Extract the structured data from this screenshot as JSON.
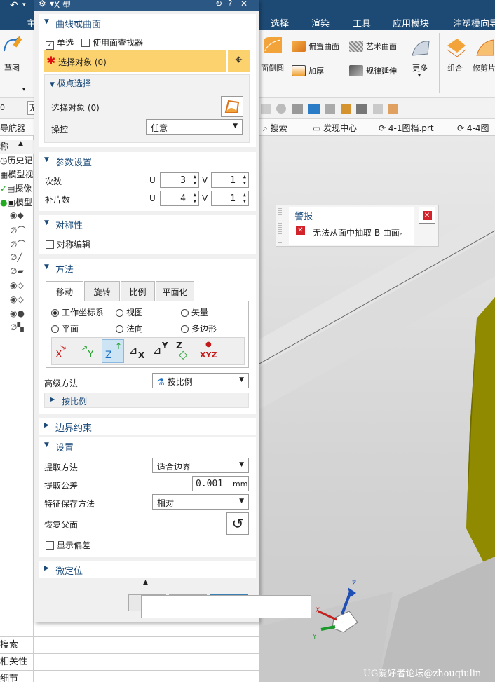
{
  "title_bar": {
    "dialog_title": "X 型",
    "controls": [
      "↻",
      "?",
      "✕"
    ]
  },
  "ribbon_tabs": [
    "选择",
    "渲染",
    "工具",
    "应用模块",
    "注塑模向导"
  ],
  "ribbon_left": {
    "tab_fragment": "主",
    "sketch_label": "草图"
  },
  "ribbon_buttons": {
    "face_fillet": "面倒圆",
    "offset_surface": "偏置曲面",
    "art_surface": "艺术曲面",
    "more": "更多",
    "thicken": "加厚",
    "ruled_extend": "规律延伸",
    "combine": "组合",
    "trim_sheet": "修剪片"
  },
  "toolbar2": {
    "left_values": [
      "0",
      "无"
    ]
  },
  "navbar": {
    "left_label": "导航器",
    "search": "搜索",
    "discover": "发现中心",
    "file1": "4-1图档.prt",
    "file2": "4-4图"
  },
  "left_panel": {
    "header": "称",
    "rows": [
      "历史记",
      "模型视",
      "摄像",
      "模型"
    ]
  },
  "bottom_panels": [
    "搜索",
    "相关性",
    "细节"
  ],
  "dialog": {
    "sections": {
      "curve_or_surface": "曲线或曲面",
      "params": "参数设置",
      "symmetry": "对称性",
      "method": "方法",
      "boundary": "边界约束",
      "settings": "设置",
      "micro": "微定位"
    },
    "single_select": "单选",
    "use_face_finder": "使用面查找器",
    "select_object": "选择对象 (0)",
    "pole_select": "极点选择",
    "pole_select_object": "选择对象 (0)",
    "manipulate_label": "操控",
    "manipulate_value": "任意",
    "degree_label": "次数",
    "patches_label": "补片数",
    "u_label": "U",
    "v_label": "V",
    "degree_u": "3",
    "degree_v": "1",
    "patches_u": "4",
    "patches_v": "1",
    "symmetric_edit": "对称编辑",
    "method_tabs": [
      "移动",
      "旋转",
      "比例",
      "平面化"
    ],
    "radios": [
      "工作坐标系",
      "视图",
      "矢量",
      "平面",
      "法向",
      "多边形"
    ],
    "axis_buttons": [
      "X",
      "Y",
      "Z",
      "X",
      "Y",
      "Z",
      "XYZ"
    ],
    "advanced_method_label": "高级方法",
    "advanced_method_value": "按比例",
    "by_ratio": "按比例",
    "extract_method_label": "提取方法",
    "extract_method_value": "适合边界",
    "extract_tol_label": "提取公差",
    "extract_tol_value": "0.001",
    "tol_unit": "mm",
    "feature_save_label": "特征保存方法",
    "feature_save_value": "相对",
    "restore_parent_label": "恢复父面",
    "show_offset": "显示偏差"
  },
  "alert": {
    "title": "警报",
    "message": "无法从面中抽取 B 曲面。"
  },
  "csys_labels": {
    "x": "X",
    "y": "Y",
    "z": "Z"
  },
  "watermark": "UG爱好者论坛@zhouqiulin",
  "colors": {
    "title_bg": "#2b5785",
    "ribbon_bg": "#1d4a74",
    "highlight": "#fcd26e",
    "model": "#8f8a00",
    "alert_x": "#d2232a"
  }
}
